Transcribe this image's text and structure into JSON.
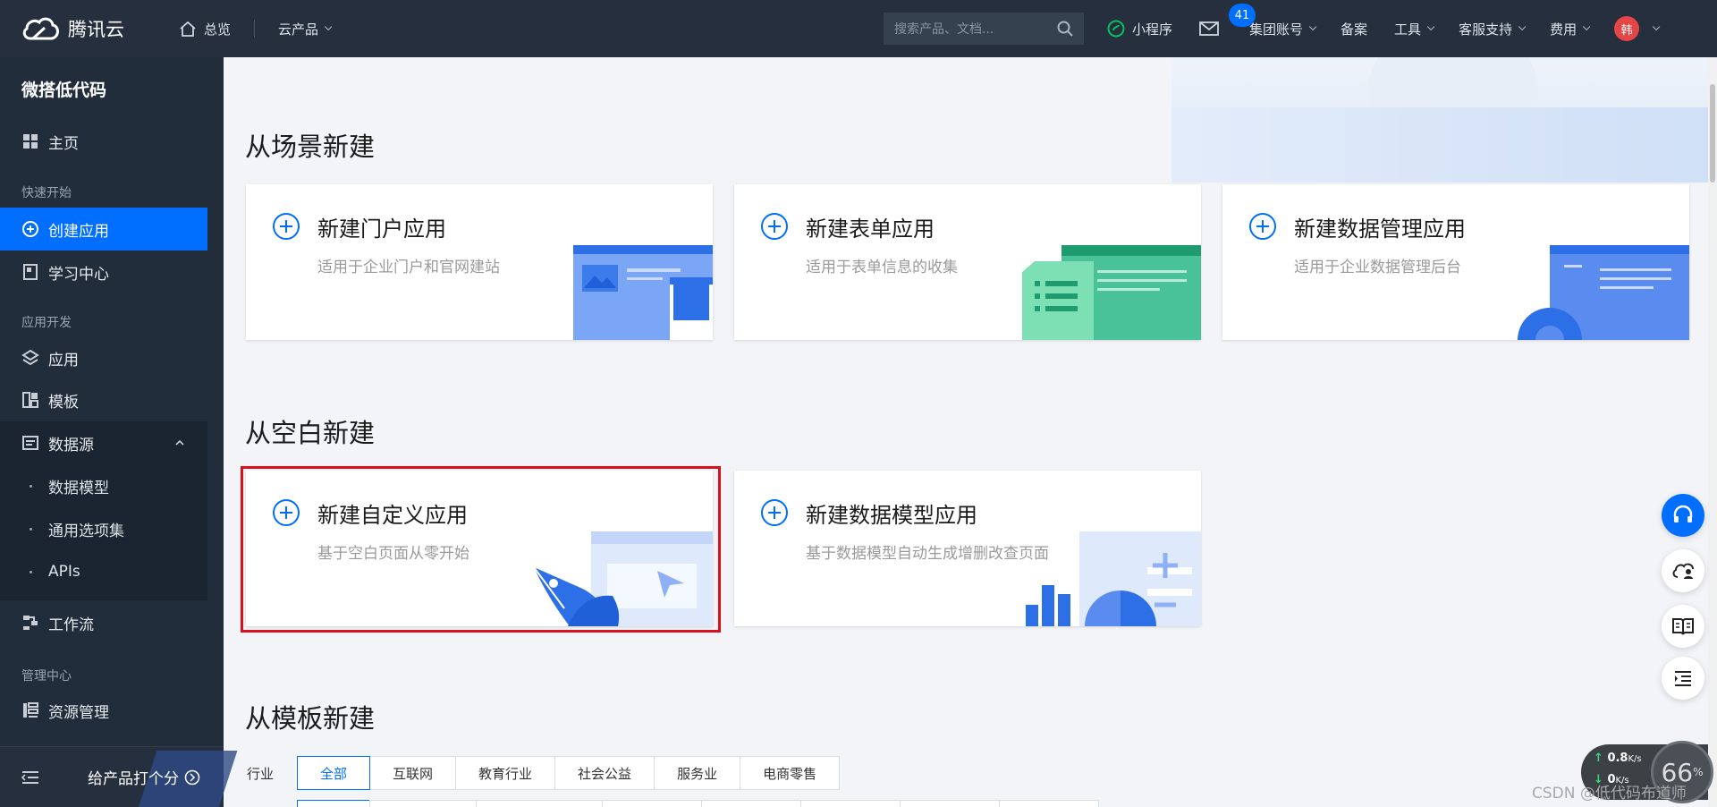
{
  "topbar": {
    "brand": "腾讯云",
    "home": "总览",
    "products": "云产品",
    "search_placeholder": "搜索产品、文档...",
    "miniprogram": "小程序",
    "mail_badge": "41",
    "account": "集团账号",
    "filing": "备案",
    "tools": "工具",
    "support": "客服支持",
    "billing": "费用",
    "avatar": "韩"
  },
  "sidebar": {
    "title": "微搭低代码",
    "home": "主页",
    "group_quickstart": "快速开始",
    "create_app": "创建应用",
    "learning": "学习中心",
    "group_dev": "应用开发",
    "apps": "应用",
    "templates": "模板",
    "datasource": "数据源",
    "data_model": "数据模型",
    "option_sets": "通用选项集",
    "apis": "APIs",
    "workflow": "工作流",
    "group_admin": "管理中心",
    "resources": "资源管理",
    "rate": "给产品打个分"
  },
  "sections": {
    "scene": "从场景新建",
    "blank": "从空白新建",
    "template": "从模板新建"
  },
  "cards": {
    "portal": {
      "title": "新建门户应用",
      "desc": "适用于企业门户和官网建站"
    },
    "form": {
      "title": "新建表单应用",
      "desc": "适用于表单信息的收集"
    },
    "data_mgmt": {
      "title": "新建数据管理应用",
      "desc": "适用于企业数据管理后台"
    },
    "custom": {
      "title": "新建自定义应用",
      "desc": "基于空白页面从零开始"
    },
    "data_model": {
      "title": "新建数据模型应用",
      "desc": "基于数据模型自动生成增删改查页面"
    }
  },
  "filter": {
    "label": "行业",
    "options": [
      "全部",
      "互联网",
      "教育行业",
      "社会公益",
      "服务业",
      "电商零售"
    ],
    "selected": "全部"
  },
  "speed": {
    "up": "0.8",
    "down": "0",
    "unit": "K/s",
    "gauge": "66"
  },
  "watermark": "CSDN @低代码布道师",
  "colors": {
    "accent": "#006eff",
    "nav_bg": "#252f3d",
    "sidebar_bg": "#222d3c",
    "highlight": "#d7121d"
  }
}
